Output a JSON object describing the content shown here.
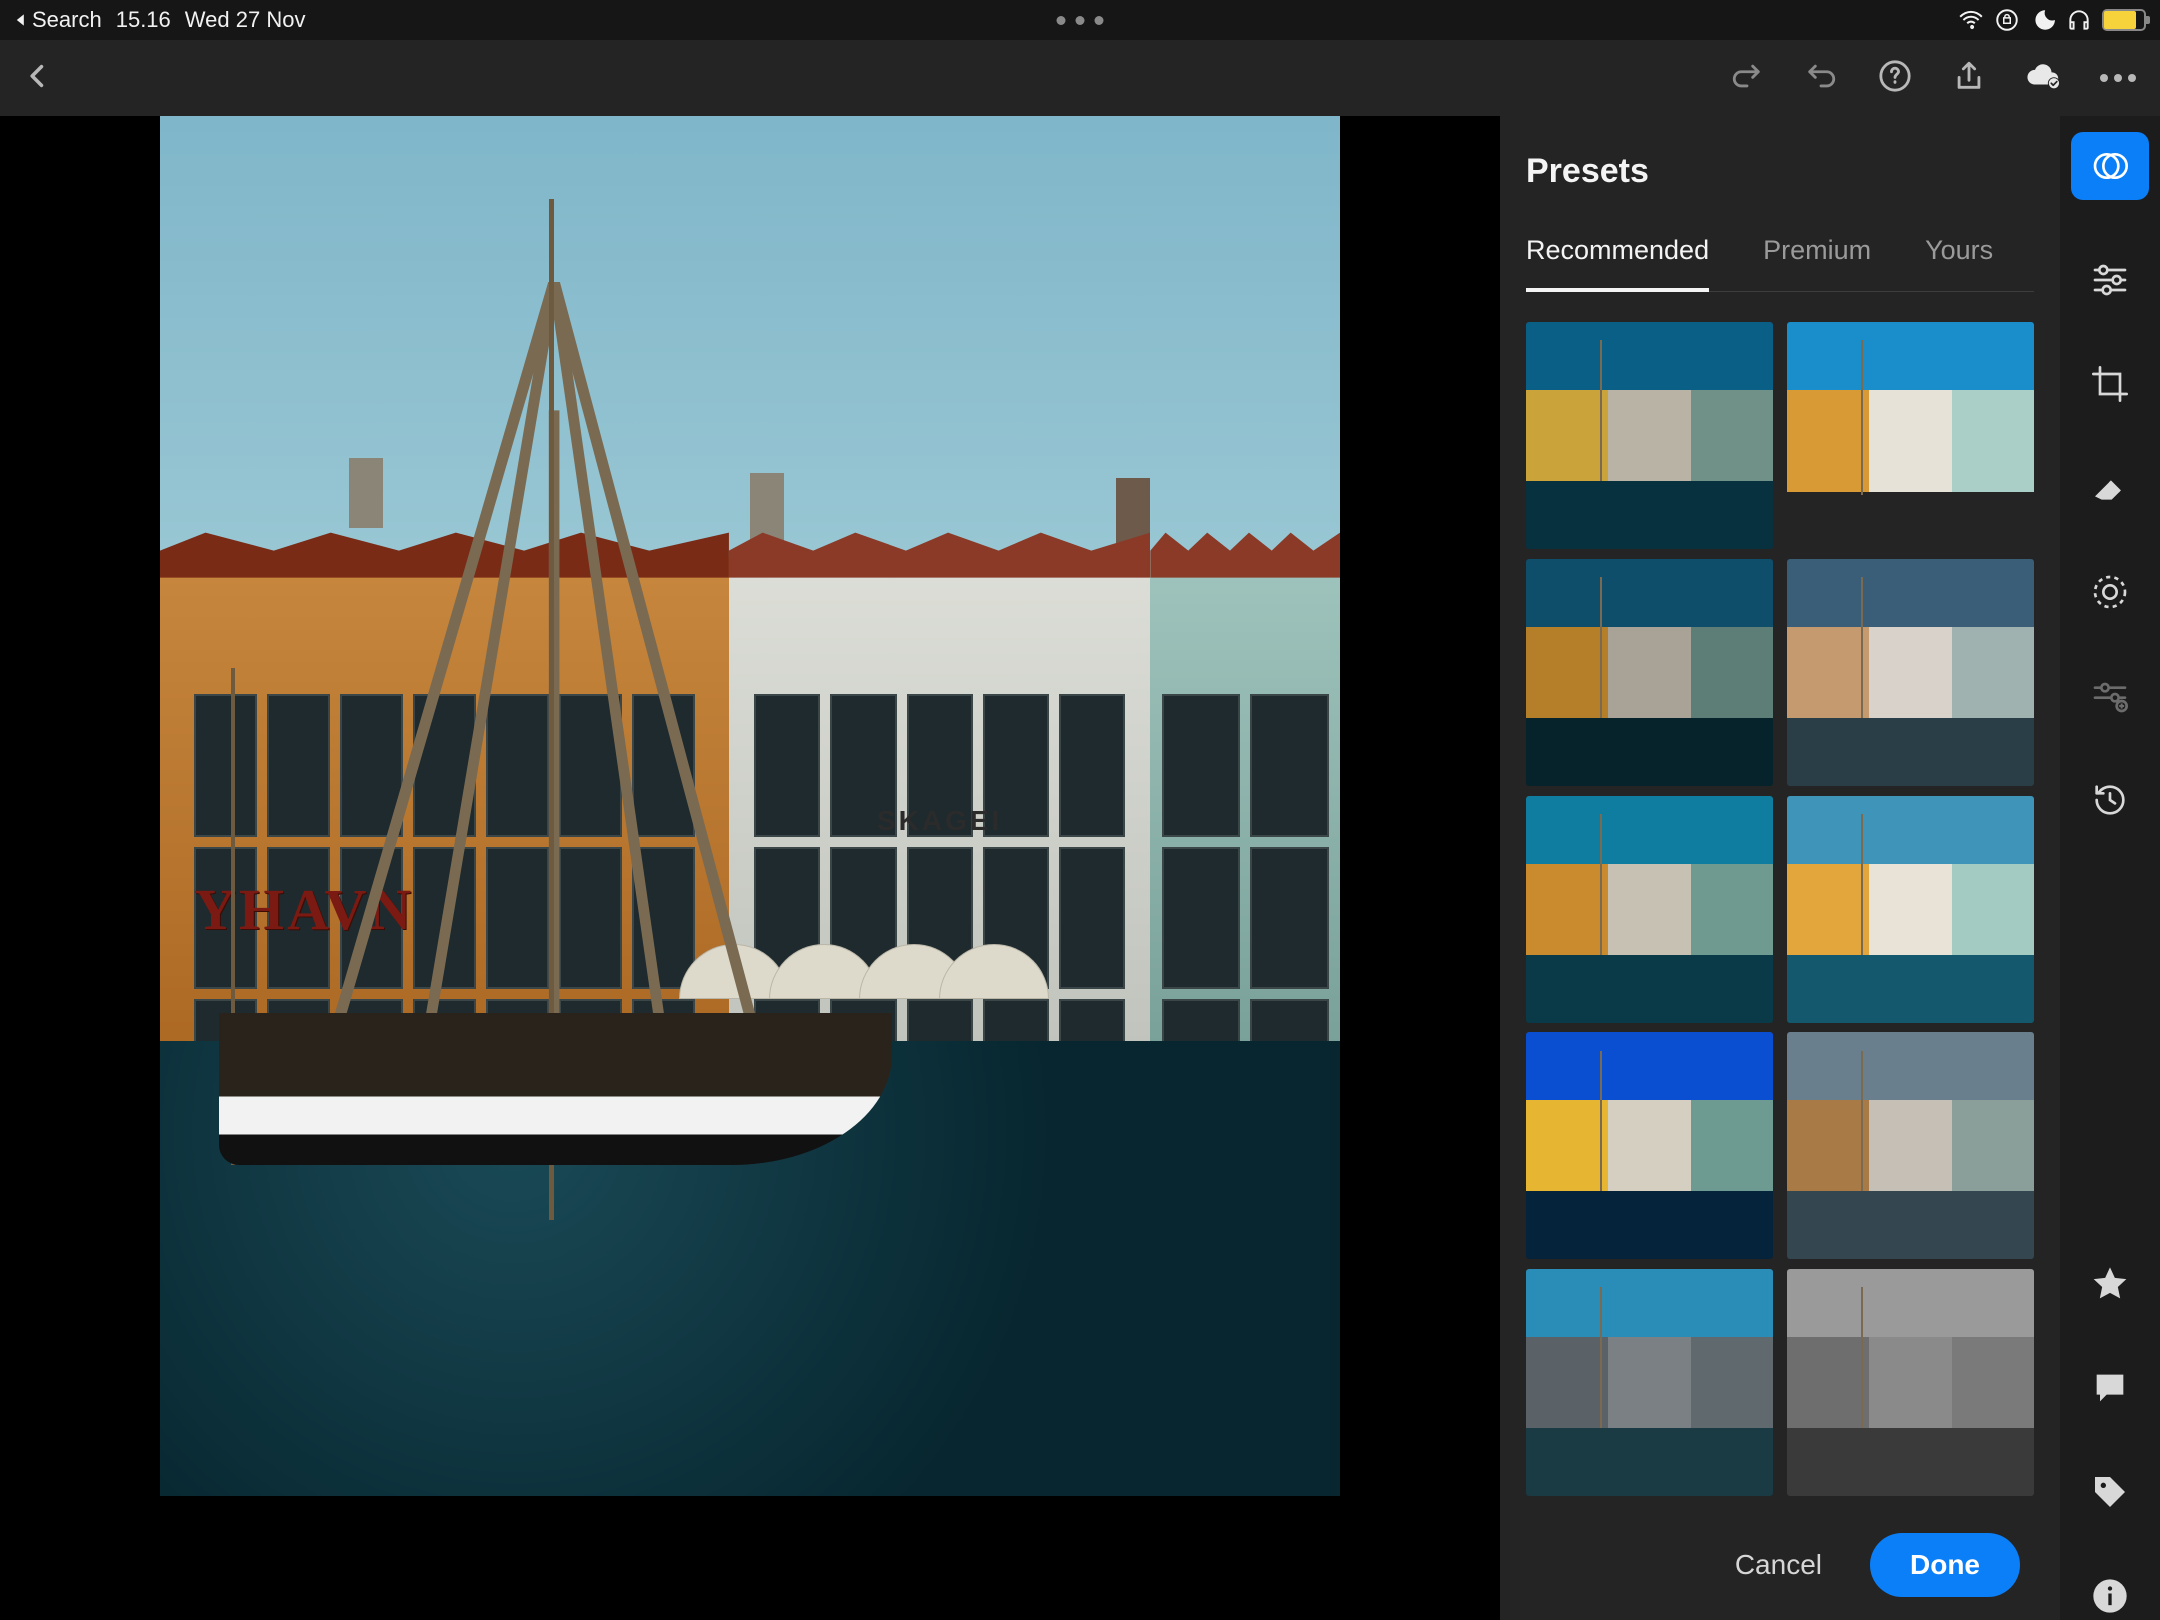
{
  "statusbar": {
    "back_app": "Search",
    "time": "15.16",
    "date": "Wed 27 Nov"
  },
  "panel": {
    "title": "Presets",
    "tabs": {
      "recommended": "Recommended",
      "premium": "Premium",
      "yours": "Yours"
    },
    "active_tab": "recommended",
    "cancel_label": "Cancel",
    "done_label": "Done"
  },
  "photo_text": {
    "sign": "YHAVN",
    "building_name": "SKAGEI"
  },
  "preset_thumbs": [
    {
      "sky": "#0a5f87",
      "bld1": "#caa33a",
      "bld2": "#b9b3a6",
      "bld3": "#6f9188",
      "water": "#083140"
    },
    {
      "sky": "#1a8ecb",
      "bld1": "#d79a34",
      "bld2": "#e6e2d7",
      "bld3": "#a9cfc6",
      "water": "#10ehigher4a5c"
    },
    {
      "sky": "#0e4e6b",
      "bld1": "#b57f2a",
      "bld2": "#a8a297",
      "bld3": "#5d7e76",
      "water": "#06232c"
    },
    {
      "sky": "#3a5d78",
      "bld1": "#c49a6e",
      "bld2": "#d9d2cb",
      "bld3": "#9fb2b0",
      "water": "#2a3e48"
    },
    {
      "sky": "#0e7da0",
      "bld1": "#c98b2d",
      "bld2": "#c7c1b3",
      "bld3": "#6f9a90",
      "water": "#0a3a47"
    },
    {
      "sky": "#3e94b9",
      "bld1": "#e2a63d",
      "bld2": "#e8e3d6",
      "bld3": "#a3cbc1",
      "water": "#14586e"
    },
    {
      "sky": "#0a4fd1",
      "bld1": "#e6b531",
      "bld2": "#d4cfc0",
      "bld3": "#6e9b91",
      "water": "#05233a"
    },
    {
      "sky": "#6a7f8e",
      "bld1": "#a87a45",
      "bld2": "#c5bfb6",
      "bld3": "#8a9e9a",
      "water": "#34464f"
    },
    {
      "sky": "#2a8db7",
      "bld1": "#5a6268",
      "bld2": "#7a8084",
      "bld3": "#606a6e",
      "water": "#1a3a44"
    },
    {
      "sky": "#9a9a9a",
      "bld1": "#6e6e6e",
      "bld2": "#8a8a8a",
      "bld3": "#7a7a7a",
      "water": "#3a3a3a"
    }
  ],
  "colors": {
    "accent": "#0b7ff7"
  }
}
